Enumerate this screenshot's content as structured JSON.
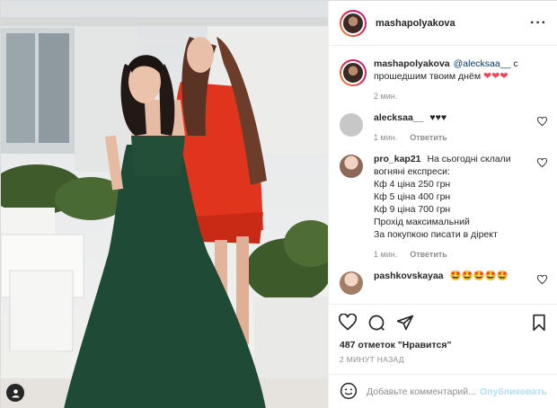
{
  "post": {
    "author": "mashapolyakova",
    "more_icon": "more-horizontal-icon"
  },
  "caption": {
    "user": "mashapolyakova",
    "mention": "@alecksaa__",
    "text": "с прошедшим твоим днём",
    "emoji": "❤❤❤",
    "time": "2 мин."
  },
  "comments": [
    {
      "user": "alecksaa__",
      "text": "♥♥♥",
      "time": "1 мин.",
      "reply": "Ответить",
      "avatar_color": "#c7c7c7"
    },
    {
      "user": "pro_kap21",
      "text": "На сьогодні склали вогняні експреси:\nКф 4 ціна 250 грн\nКф 5 ціна 400 грн\nКф 9 ціна 700 грн\nПрохід максимальний\nЗа покупкою писати в дірект",
      "time": "1 мин.",
      "reply": "Ответить",
      "avatar_color": "#d8b9a6"
    },
    {
      "user": "pashkovskayaa",
      "text": "🤩🤩🤩🤩🤩",
      "time": "",
      "reply": "",
      "avatar_color": "#e0c2b0"
    }
  ],
  "footer": {
    "likes": "487 отметок \"Нравится\"",
    "time_ago": "2 МИНУТ НАЗАД",
    "comment_placeholder": "Добавьте комментарий...",
    "publish_label": "Опубликовать"
  },
  "colors": {
    "dress_green": "#1f4a35",
    "dress_red": "#e0341c",
    "link": "#00376b",
    "publish_disabled": "#b2dffc"
  }
}
